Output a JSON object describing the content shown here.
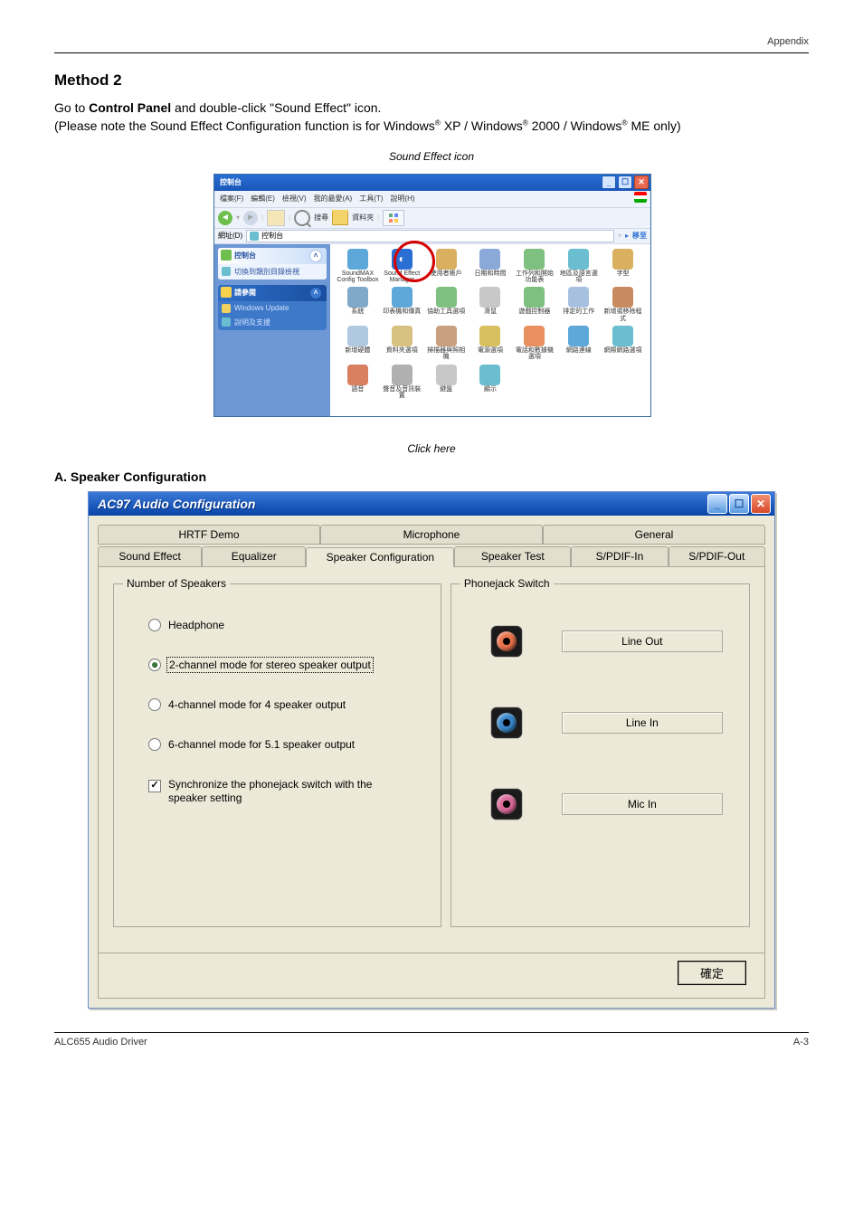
{
  "page": {
    "header_right": "Appendix",
    "footer_left": "ALC655 Audio Driver",
    "footer_right": "A-3"
  },
  "doc": {
    "heading": "Method 2",
    "intro_prefix": "Go to ",
    "intro_bold": "Control Panel",
    "intro_suffix": " and double-click \"Sound Effect\" icon.",
    "note_prefix": "(Please note the Sound Effect Configuration function is for Windows",
    "reg": "®",
    "note_mid": " XP / Windows",
    "note_end1": "2000 / Windows",
    "note_end2": " ME only)",
    "sound_effect_icon_label": "Sound Effect icon",
    "caption1": "Click here",
    "stepA": "A. Speaker Configuration"
  },
  "cp": {
    "title": "控制台",
    "menu": [
      "檔案(F)",
      "編輯(E)",
      "檢視(V)",
      "我的最愛(A)",
      "工具(T)",
      "說明(H)"
    ],
    "toolbar": {
      "search": "搜尋",
      "folders": "資料夾"
    },
    "address_label": "網址(D)",
    "address_value": "控制台",
    "go": "移至",
    "panel1": {
      "title": "控制台",
      "item": "切換到類別目錄檢視"
    },
    "panel2": {
      "title": "請參閱",
      "items": [
        "Windows Update",
        "說明及支援"
      ]
    },
    "icons": [
      {
        "label": "SoundMAX Config Toolbox",
        "color": "#5da8d8"
      },
      {
        "label": "Sound Effect Manager",
        "color": "#2a6fd4",
        "glyph": "◐"
      },
      {
        "label": "使用者帳戶",
        "color": "#d8b060"
      },
      {
        "label": "日期和時間",
        "color": "#8aa8d8"
      },
      {
        "label": "工作列和開始功能表",
        "color": "#7fc080"
      },
      {
        "label": "地區及語言選項",
        "color": "#6abed0"
      },
      {
        "label": "字型",
        "color": "#d8b060"
      },
      {
        "label": "系統",
        "color": "#80a8c8"
      },
      {
        "label": "印表機和傳真",
        "color": "#5da8d8"
      },
      {
        "label": "協助工具選項",
        "color": "#7fc080"
      },
      {
        "label": "滑鼠",
        "color": "#c8c8c8"
      },
      {
        "label": "遊戲控制器",
        "color": "#7fc080"
      },
      {
        "label": "排定的工作",
        "color": "#a8c0e0"
      },
      {
        "label": "新增或移除程式",
        "color": "#c88a60"
      },
      {
        "label": "新增硬體",
        "color": "#b0c8e0"
      },
      {
        "label": "資料夾選項",
        "color": "#d8c080"
      },
      {
        "label": "掃描器與照相機",
        "color": "#c8a080"
      },
      {
        "label": "電源選項",
        "color": "#d8c060"
      },
      {
        "label": "電話和數據機選項",
        "color": "#e89060"
      },
      {
        "label": "網路連線",
        "color": "#5da8d8"
      },
      {
        "label": "網際網路選項",
        "color": "#6abed0"
      },
      {
        "label": "語音",
        "color": "#d88060"
      },
      {
        "label": "聲音及音訊裝置",
        "color": "#b0b0b0"
      },
      {
        "label": "鍵盤",
        "color": "#c8c8c8"
      },
      {
        "label": "顯示",
        "color": "#6abed0"
      }
    ]
  },
  "ac": {
    "title": "AC97 Audio Configuration",
    "tabs_top": [
      "HRTF Demo",
      "Microphone",
      "General"
    ],
    "tabs_bottom": [
      "Sound Effect",
      "Equalizer",
      "Speaker Configuration",
      "Speaker Test",
      "S/PDIF-In",
      "S/PDIF-Out"
    ],
    "group1": {
      "legend": "Number of Speakers",
      "radios": [
        {
          "label": "Headphone",
          "selected": false
        },
        {
          "label": "2-channel mode for stereo speaker output",
          "selected": true,
          "dotted": true
        },
        {
          "label": "4-channel mode for 4 speaker output",
          "selected": false
        },
        {
          "label": "6-channel mode for 5.1 speaker output",
          "selected": false
        }
      ],
      "checkbox": {
        "label": "Synchronize the phonejack switch with the speaker setting",
        "checked": true
      }
    },
    "group2": {
      "legend": "Phonejack Switch",
      "jacks": [
        {
          "color": "#e8704a",
          "label": "Line Out"
        },
        {
          "color": "#3886c8",
          "label": "Line In"
        },
        {
          "color": "#d86a9a",
          "label": "Mic In"
        }
      ]
    },
    "ok": "確定"
  }
}
